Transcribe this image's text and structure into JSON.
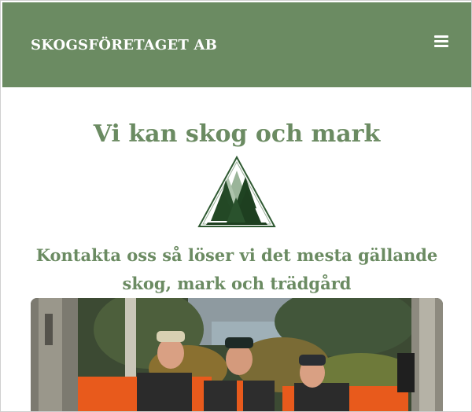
{
  "header": {
    "brand": "SKOGSFÖRETAGET AB",
    "menu_icon": "hamburger-menu-icon",
    "background_color": "#6b8b62"
  },
  "hero": {
    "title": "Vi kan skog och mark",
    "logo_icon": "forest-triangle-logo",
    "tagline": "Kontakta oss så löser vi det mesta gällande skog, mark och trädgård",
    "accent_color": "#6b8b62"
  },
  "photo": {
    "subject": "team-photo"
  }
}
